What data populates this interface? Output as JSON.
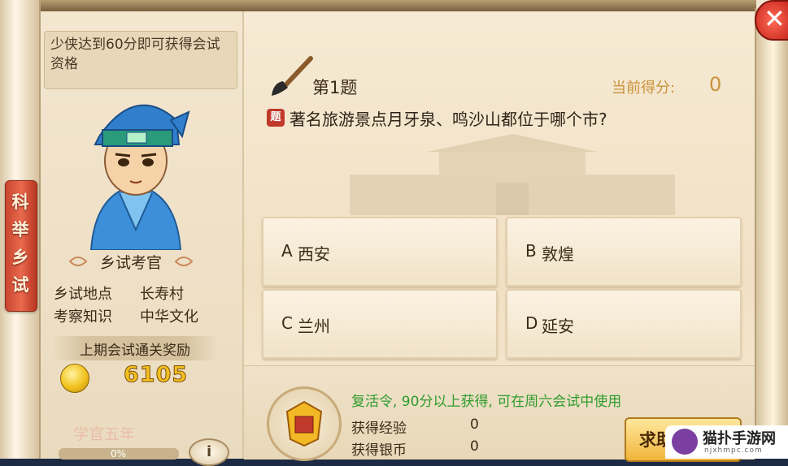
{
  "side_tab": {
    "label": "科举乡试"
  },
  "hint": {
    "text": "少侠达到60分即可获得会试资格"
  },
  "examiner": {
    "title": "乡试考官",
    "location_label": "乡试地点",
    "location_value": "长寿村",
    "topic_label": "考察知识",
    "topic_value": "中华文化"
  },
  "reward": {
    "header": "上期会试通关奖励",
    "amount": "6105"
  },
  "rank": {
    "text": "学官五年",
    "progress": "0%"
  },
  "info_button": {
    "label": "i"
  },
  "question": {
    "number_label": "第1题",
    "score_label": "当前得分:",
    "score_value": "0",
    "icon_label": "题",
    "text": "著名旅游景点月牙泉、鸣沙山都位于哪个市?"
  },
  "options": [
    {
      "letter": "A",
      "text": "西安"
    },
    {
      "letter": "B",
      "text": "敦煌"
    },
    {
      "letter": "C",
      "text": "兰州"
    },
    {
      "letter": "D",
      "text": "延安"
    }
  ],
  "bottom": {
    "revive_text": "复活令, 90分以上获得, 可在周六会试中使用",
    "exp_label": "获得经验",
    "exp_value": "0",
    "silver_label": "获得银币",
    "silver_value": "0",
    "help_button": "求助"
  },
  "close_button": {
    "label": "✕"
  },
  "watermark": {
    "text": "猫扑手游网",
    "sub": "njxhmpc.com"
  },
  "colors": {
    "accent_gold": "#f4c021",
    "score_color": "#c9933a",
    "revive_green": "#2e9b2e",
    "tab_red": "#c8452f"
  }
}
